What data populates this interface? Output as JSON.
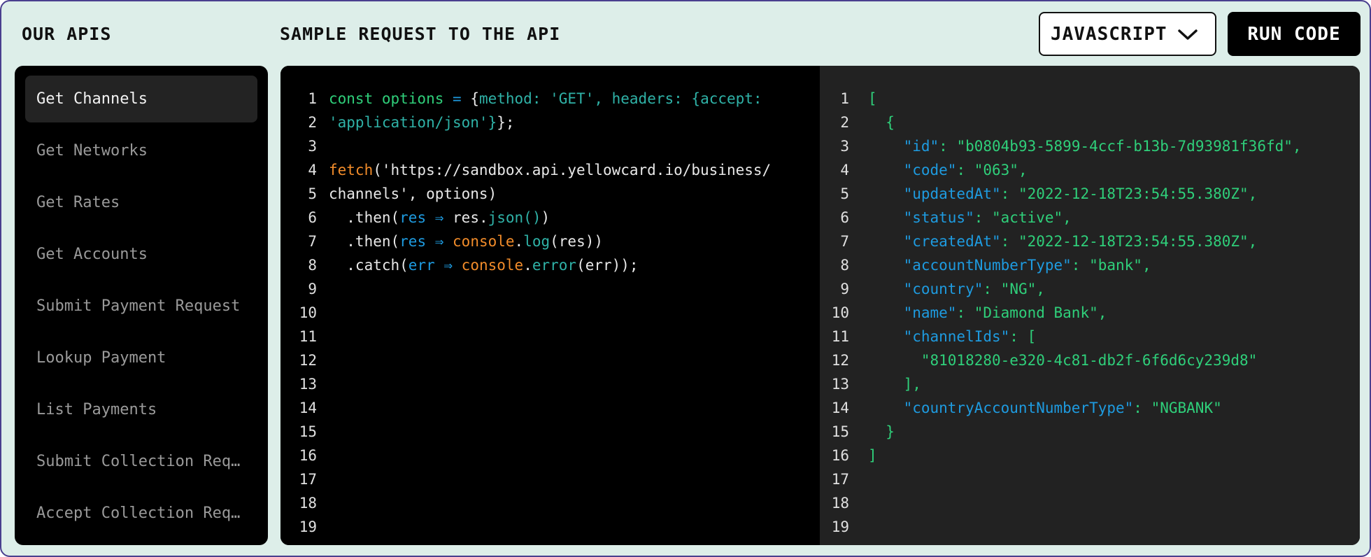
{
  "header": {
    "apis_title": "OUR APIS",
    "sample_title": "SAMPLE REQUEST TO THE API",
    "language_select": "JAVASCRIPT",
    "run_button": "RUN CODE"
  },
  "sidebar": {
    "items": [
      {
        "label": "Get Channels",
        "active": true
      },
      {
        "label": "Get Networks",
        "active": false
      },
      {
        "label": "Get Rates",
        "active": false
      },
      {
        "label": "Get Accounts",
        "active": false
      },
      {
        "label": "Submit Payment Request",
        "active": false
      },
      {
        "label": "Lookup Payment",
        "active": false
      },
      {
        "label": "List Payments",
        "active": false
      },
      {
        "label": "Submit Collection Req…",
        "active": false
      },
      {
        "label": "Accept Collection Req…",
        "active": false
      }
    ]
  },
  "code": {
    "line_numbers": [
      "1",
      "2",
      "3",
      "4",
      "5",
      "6",
      "7",
      "8",
      "9",
      "10",
      "11",
      "12",
      "13",
      "14",
      "15",
      "16",
      "17",
      "18",
      "19"
    ],
    "lines": [
      [
        [
          "const ",
          "#2fcf7a"
        ],
        [
          "options",
          "#2fcf7a"
        ],
        [
          " = ",
          "#1e9be0"
        ],
        [
          "{",
          "#e8e8e8"
        ],
        [
          "method: ",
          "#2fb2a7"
        ],
        [
          "'GET'",
          "#2fb2a7"
        ],
        [
          ", headers: ",
          "#2fb2a7"
        ],
        [
          "{accept:",
          "#2fb2a7"
        ]
      ],
      [
        [
          "'application/json'",
          "#2fb2a7"
        ],
        [
          "}",
          "#2fb2a7"
        ],
        [
          "};",
          "#e8e8e8"
        ]
      ],
      [],
      [
        [
          "fetch",
          "#f28c2a"
        ],
        [
          "('https://sandbox.api.yellowcard.io/business/",
          "#e8e8e8"
        ]
      ],
      [
        [
          "channels', options)",
          "#e8e8e8"
        ]
      ],
      [
        [
          "  .then(",
          "#e8e8e8"
        ],
        [
          "res",
          "#1e9be0"
        ],
        [
          " ⇒ ",
          "#1e9be0"
        ],
        [
          "res.",
          "#e8e8e8"
        ],
        [
          "json()",
          "#2fb2a7"
        ],
        [
          ")",
          "#e8e8e8"
        ]
      ],
      [
        [
          "  .then(",
          "#e8e8e8"
        ],
        [
          "res",
          "#1e9be0"
        ],
        [
          " ⇒ ",
          "#1e9be0"
        ],
        [
          "console",
          "#f28c2a"
        ],
        [
          ".",
          "#e8e8e8"
        ],
        [
          "log",
          "#2fb2a7"
        ],
        [
          "(res))",
          "#e8e8e8"
        ]
      ],
      [
        [
          "  .catch(",
          "#e8e8e8"
        ],
        [
          "err",
          "#1e9be0"
        ],
        [
          " ⇒ ",
          "#1e9be0"
        ],
        [
          "console",
          "#f28c2a"
        ],
        [
          ".",
          "#e8e8e8"
        ],
        [
          "error",
          "#2fb2a7"
        ],
        [
          "(err));",
          "#e8e8e8"
        ]
      ]
    ]
  },
  "response": {
    "line_numbers": [
      "1",
      "2",
      "3",
      "4",
      "5",
      "6",
      "7",
      "8",
      "9",
      "10",
      "11",
      "12",
      "13",
      "14",
      "15",
      "16",
      "17",
      "18",
      "19"
    ],
    "lines": [
      [
        [
          "[",
          "#2fcf7a"
        ]
      ],
      [
        [
          "  {",
          "#2fcf7a"
        ]
      ],
      [
        [
          "    \"id\"",
          "#1e9be0"
        ],
        [
          ": ",
          "#2fcf7a"
        ],
        [
          "\"b0804b93-5899-4ccf-b13b-7d93981f36fd\",",
          "#2fcf7a"
        ]
      ],
      [
        [
          "    \"code\"",
          "#1e9be0"
        ],
        [
          ": ",
          "#2fcf7a"
        ],
        [
          "\"063\",",
          "#2fcf7a"
        ]
      ],
      [
        [
          "    \"updatedAt\"",
          "#1e9be0"
        ],
        [
          ": ",
          "#2fcf7a"
        ],
        [
          "\"2022-12-18T23:54:55.380Z\",",
          "#2fcf7a"
        ]
      ],
      [
        [
          "    \"status\"",
          "#1e9be0"
        ],
        [
          ": ",
          "#2fcf7a"
        ],
        [
          "\"active\",",
          "#2fcf7a"
        ]
      ],
      [
        [
          "    \"createdAt\"",
          "#1e9be0"
        ],
        [
          ": ",
          "#2fcf7a"
        ],
        [
          "\"2022-12-18T23:54:55.380Z\",",
          "#2fcf7a"
        ]
      ],
      [
        [
          "    \"accountNumberType\"",
          "#1e9be0"
        ],
        [
          ": ",
          "#2fcf7a"
        ],
        [
          "\"bank\",",
          "#2fcf7a"
        ]
      ],
      [
        [
          "    \"country\"",
          "#1e9be0"
        ],
        [
          ": ",
          "#2fcf7a"
        ],
        [
          "\"NG\",",
          "#2fcf7a"
        ]
      ],
      [
        [
          "    \"name\"",
          "#1e9be0"
        ],
        [
          ": ",
          "#2fcf7a"
        ],
        [
          "\"Diamond Bank\",",
          "#2fcf7a"
        ]
      ],
      [
        [
          "    \"channelIds\"",
          "#1e9be0"
        ],
        [
          ": [",
          "#2fcf7a"
        ]
      ],
      [
        [
          "      \"81018280-e320-4c81-db2f-6f6d6cy239d8\"",
          "#2fcf7a"
        ]
      ],
      [
        [
          "    ],",
          "#2fcf7a"
        ]
      ],
      [
        [
          "    \"countryAccountNumberType\"",
          "#1e9be0"
        ],
        [
          ": ",
          "#2fcf7a"
        ],
        [
          "\"NGBANK\"",
          "#2fcf7a"
        ]
      ],
      [
        [
          "  }",
          "#2fcf7a"
        ]
      ],
      [
        [
          "]",
          "#2fcf7a"
        ]
      ]
    ]
  },
  "colors": {
    "frame_bg": "#ddeee9",
    "sidebar_bg": "#000000",
    "sidebar_active_bg": "#232323",
    "code_bg": "#000000",
    "json_bg": "#222222",
    "keyword_green": "#2fcf7a",
    "keyword_blue": "#1e9be0",
    "keyword_orange": "#f28c2a",
    "string_teal": "#2fb2a7"
  },
  "icons": {
    "dropdown": "chevron-down-icon"
  }
}
